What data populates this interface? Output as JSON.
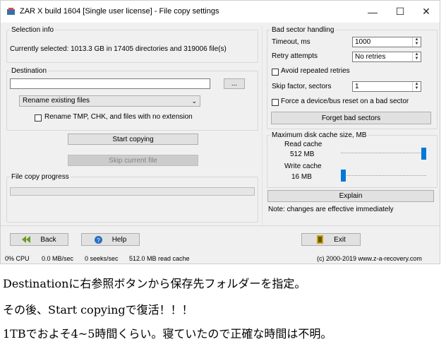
{
  "window": {
    "title": "ZAR X build 1604 [Single user license] - File copy settings",
    "minimize": "—",
    "maximize": "☐",
    "close": "✕"
  },
  "selection": {
    "legend": "Selection info",
    "text": "Currently selected: 1013.3 GB in 17405 directories and 319006 file(s)"
  },
  "destination": {
    "legend": "Destination",
    "path_value": "",
    "browse_label": "...",
    "mode_selected": "Rename existing files",
    "rename_checkbox_label": "Rename TMP, CHK, and files with no extension",
    "rename_checked": false
  },
  "actions": {
    "start_copying": "Start copying",
    "skip_current_file": "Skip current file"
  },
  "progress": {
    "legend": "File copy progress",
    "value": 0
  },
  "bad_sector": {
    "legend": "Bad sector handling",
    "timeout_label": "Timeout, ms",
    "timeout_value": "1000",
    "retry_label": "Retry attempts",
    "retry_value": "No retries",
    "avoid_label": "Avoid repeated retries",
    "avoid_checked": false,
    "skip_label": "Skip factor, sectors",
    "skip_value": "1",
    "force_label": "Force a device/bus reset on a bad sector",
    "force_checked": false,
    "forget_button": "Forget bad sectors"
  },
  "cache": {
    "legend": "Maximum disk cache size, MB",
    "read_label": "Read cache",
    "read_value": "512 MB",
    "read_level": 1.0,
    "write_label": "Write cache",
    "write_value": "16 MB",
    "write_level": 0.0,
    "explain_button": "Explain",
    "note": "Note: changes are effective immediately"
  },
  "bottom": {
    "back": "Back",
    "help": "Help",
    "exit": "Exit"
  },
  "status": {
    "cpu": "0% CPU",
    "speed": "0.0 MB/sec",
    "seeks": "0 seeks/sec",
    "cache_read": "512.0 MB read cache",
    "copyright": "(c) 2000-2019 www.z-a-recovery.com"
  },
  "captions": [
    "Destinationに右参照ボタンから保存先フォルダーを指定。",
    "その後、Start copyingで復活！！！",
    "1TBでおよそ4~5時間くらい。寝ていたので正確な時間は不明。"
  ],
  "colors": {
    "accent": "#0078d7",
    "back_arrow": "#6a9a1f",
    "help_icon": "#2a6fc0",
    "exit_icon": "#c8a000"
  }
}
